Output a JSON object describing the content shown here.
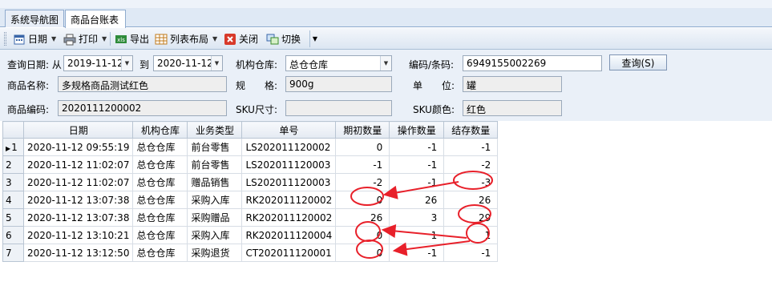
{
  "tabs": [
    "系统导航图",
    "商品台账表"
  ],
  "toolbar": {
    "date_label": "日期",
    "print_label": "打印",
    "export_label": "导出",
    "layout_label": "列表布局",
    "close_label": "关闭",
    "switch_label": "切换"
  },
  "filters": {
    "query_date_label": "查询日期: 从",
    "date_from": "2019-11-12",
    "to_label": "到",
    "date_to": "2020-11-12",
    "warehouse_label": "机构仓库:",
    "warehouse_value": "总仓仓库",
    "barcode_label": "编码/条码:",
    "barcode_value": "6949155002269",
    "query_button": "查询(S)",
    "product_name_label": "商品名称:",
    "product_name_value": "多规格商品测试红色",
    "spec_label": "规　　格:",
    "spec_value": "900g",
    "unit_label": "单　　位:",
    "unit_value": "罐",
    "product_code_label": "商品编码:",
    "product_code_value": "2020111200002",
    "sku_size_label": "SKU尺寸:",
    "sku_size_value": "",
    "sku_color_label": "SKU颜色:",
    "sku_color_value": "红色"
  },
  "grid": {
    "headers": [
      "日期",
      "机构仓库",
      "业务类型",
      "单号",
      "期初数量",
      "操作数量",
      "结存数量"
    ],
    "rows": [
      {
        "no": "1",
        "date": "2020-11-12 09:55:19",
        "warehouse": "总仓仓库",
        "type": "前台零售",
        "order": "LS202011120002",
        "opening": "0",
        "operation": "-1",
        "balance": "-1"
      },
      {
        "no": "2",
        "date": "2020-11-12 11:02:07",
        "warehouse": "总仓仓库",
        "type": "前台零售",
        "order": "LS202011120003",
        "opening": "-1",
        "operation": "-1",
        "balance": "-2"
      },
      {
        "no": "3",
        "date": "2020-11-12 11:02:07",
        "warehouse": "总仓仓库",
        "type": "赠品销售",
        "order": "LS202011120003",
        "opening": "-2",
        "operation": "-1",
        "balance": "-3"
      },
      {
        "no": "4",
        "date": "2020-11-12 13:07:38",
        "warehouse": "总仓仓库",
        "type": "采购入库",
        "order": "RK202011120002",
        "opening": "0",
        "operation": "26",
        "balance": "26"
      },
      {
        "no": "5",
        "date": "2020-11-12 13:07:38",
        "warehouse": "总仓仓库",
        "type": "采购赠品",
        "order": "RK202011120002",
        "opening": "26",
        "operation": "3",
        "balance": "29"
      },
      {
        "no": "6",
        "date": "2020-11-12 13:10:21",
        "warehouse": "总仓仓库",
        "type": "采购入库",
        "order": "RK202011120004",
        "opening": "0",
        "operation": "1",
        "balance": "1"
      },
      {
        "no": "7",
        "date": "2020-11-12 13:12:50",
        "warehouse": "总仓仓库",
        "type": "采购退货",
        "order": "CT202011120001",
        "opening": "0",
        "operation": "-1",
        "balance": "-1"
      }
    ]
  },
  "annotation_color": "#e8202a"
}
